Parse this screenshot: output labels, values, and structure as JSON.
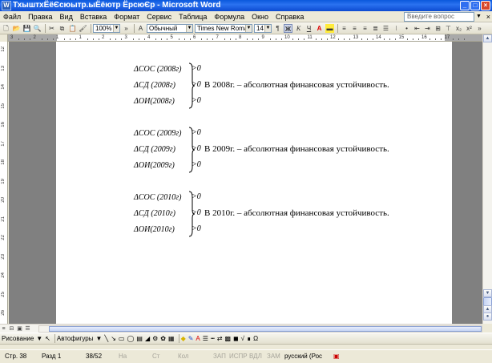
{
  "window": {
    "title": "ТхыштхЁёЄсюытр.ыЁёютр ЁрсюЄр - Microsoft Word",
    "icon": "W"
  },
  "menu": {
    "items": [
      "Файл",
      "Правка",
      "Вид",
      "Вставка",
      "Формат",
      "Сервис",
      "Таблица",
      "Формула",
      "Окно",
      "Справка"
    ],
    "help_placeholder": "Введите вопрос"
  },
  "toolbar": {
    "zoom": "100%",
    "style": "Обычный",
    "font": "Times New Roman",
    "size": "14",
    "bold": "Ж",
    "italic": "К",
    "underline": "Ч",
    "font_color_letter": "A"
  },
  "ruler": {
    "numbers": [
      "3",
      "2",
      "1",
      "1",
      "2",
      "3",
      "4",
      "5",
      "6",
      "7",
      "8",
      "9",
      "10",
      "11",
      "12",
      "13",
      "14",
      "15",
      "16",
      "17"
    ],
    "vnumbers": [
      "12",
      "13",
      "14",
      "15",
      "16",
      "17",
      "18",
      "19",
      "20",
      "21",
      "22",
      "23",
      "24",
      "25",
      "26"
    ]
  },
  "document": {
    "groups": [
      {
        "lines": [
          {
            "lhs": "ΔСОС (2008г)",
            "rel": ">0"
          },
          {
            "lhs": "ΔСД (2008г)",
            "rel": ">0",
            "text": "В 2008г. – абсолютная финансовая устойчивость."
          },
          {
            "lhs": "ΔОИ(2008г)",
            "rel": ">0"
          }
        ]
      },
      {
        "lines": [
          {
            "lhs": "ΔСОС (2009г)",
            "rel": ">0"
          },
          {
            "lhs": "ΔСД (2009г)",
            "rel": ">0",
            "text": "В 2009г. – абсолютная финансовая устойчивость."
          },
          {
            "lhs": "ΔОИ(2009г)",
            "rel": ">0"
          }
        ]
      },
      {
        "lines": [
          {
            "lhs": "ΔСОС (2010г)",
            "rel": ">0"
          },
          {
            "lhs": "ΔСД (2010г)",
            "rel": ">0",
            "text": "В 2010г. – абсолютная финансовая устойчивость."
          },
          {
            "lhs": "ΔОИ(2010г)",
            "rel": ">0"
          }
        ]
      }
    ]
  },
  "drawbar": {
    "drawing": "Рисование",
    "autoshapes": "Автофигуры"
  },
  "status": {
    "page": "Стр. 38",
    "section": "Разд 1",
    "pages": "38/52",
    "at": "На",
    "line": "Ст",
    "col": "Кол",
    "rec": "ЗАП",
    "trk": "ИСПР",
    "ext": "ВДЛ",
    "ovr": "ЗАМ",
    "lang": "русский (Рос"
  },
  "colors": {
    "titlebar": "#0a58dc",
    "chrome": "#ece9d8",
    "workspace": "#808080"
  }
}
